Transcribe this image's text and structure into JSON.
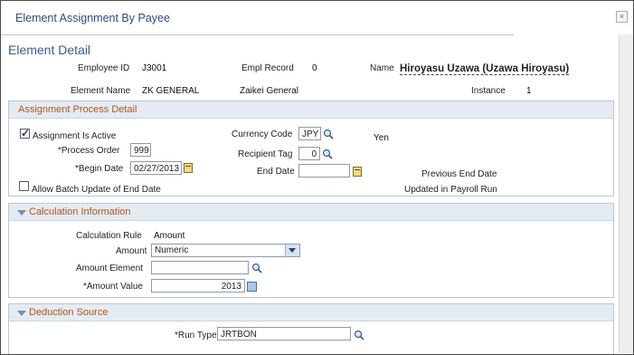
{
  "window": {
    "title": "Element Assignment By Payee",
    "close_label": "×"
  },
  "page": {
    "title": "Element Detail"
  },
  "header": {
    "employee_id_label": "Employee ID",
    "employee_id": "J3001",
    "empl_record_label": "Empl Record",
    "empl_record": "0",
    "name_label": "Name",
    "name": "Hiroyasu Uzawa (Uzawa Hiroyasu)",
    "element_name_label": "Element Name",
    "element_name": "ZK GENERAL",
    "element_desc": "Zaikei General",
    "instance_label": "Instance",
    "instance": "1"
  },
  "assignment": {
    "section_title": "Assignment Process Detail",
    "active_label": "Assignment Is Active",
    "active_checked": true,
    "process_order_label": "*Process Order",
    "process_order": "999",
    "begin_date_label": "*Begin Date",
    "begin_date": "02/27/2013",
    "batch_update_label": "Allow Batch Update of End Date",
    "batch_update_checked": false,
    "currency_code_label": "Currency Code",
    "currency_code": "JPY",
    "currency_desc": "Yen",
    "recipient_tag_label": "Recipient Tag",
    "recipient_tag": "0",
    "end_date_label": "End Date",
    "end_date": "",
    "prev_end_date_label": "Previous End Date",
    "updated_label": "Updated in Payroll Run"
  },
  "calculation": {
    "section_title": "Calculation Information",
    "rule_label": "Calculation Rule",
    "rule": "Amount",
    "amount_label": "Amount",
    "amount_selected": "Numeric",
    "amount_element_label": "Amount Element",
    "amount_element": "",
    "amount_value_label": "*Amount Value",
    "amount_value": "2013"
  },
  "deduction": {
    "section_title": "Deduction Source",
    "run_type_label": "*Run Type",
    "run_type": "JRTBON"
  }
}
